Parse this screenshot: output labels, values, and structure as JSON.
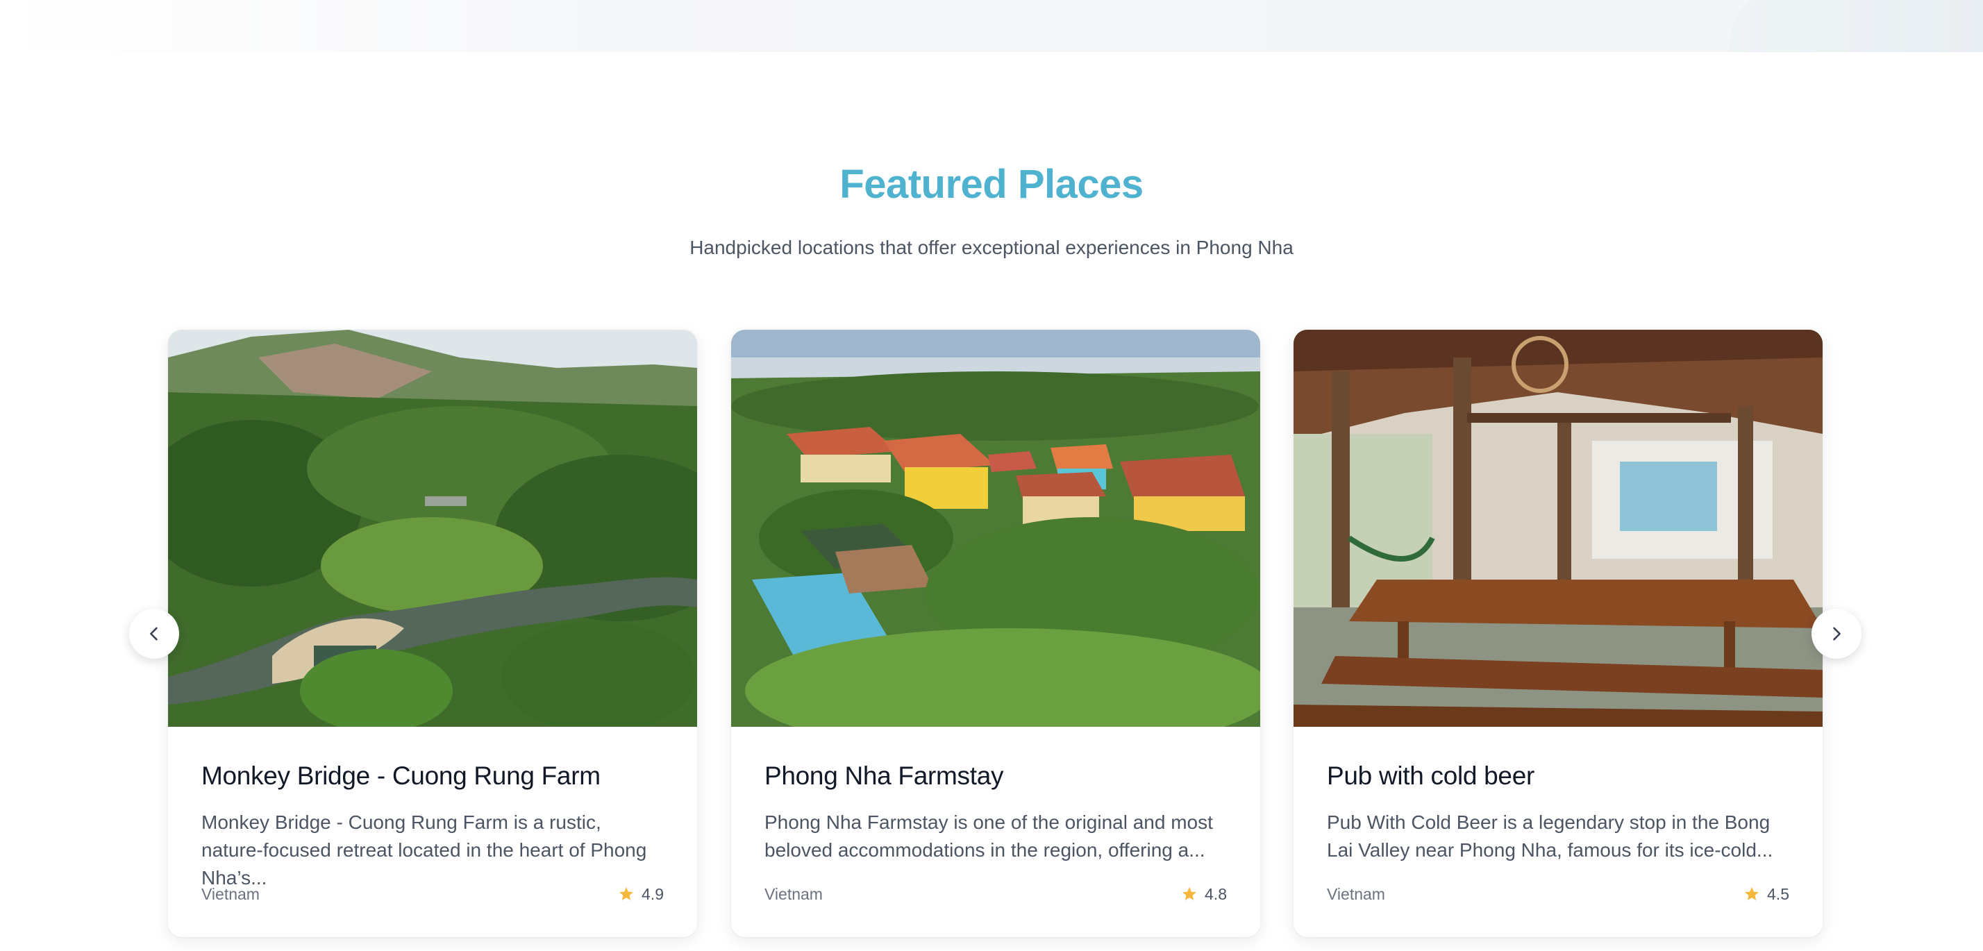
{
  "section": {
    "title": "Featured Places",
    "subtitle": "Handpicked locations that offer exceptional experiences in Phong Nha"
  },
  "carousel": {
    "prev_icon": "chevron-left-icon",
    "next_icon": "chevron-right-icon"
  },
  "cards": [
    {
      "title": "Monkey Bridge - Cuong Rung Farm",
      "description": "Monkey Bridge - Cuong Rung Farm is a rustic, nature-focused retreat located in the heart of Phong Nha’s...",
      "location": "Vietnam",
      "rating": "4.9",
      "image": "aerial view of forested river valley with farm"
    },
    {
      "title": "Phong Nha Farmstay",
      "description": "Phong Nha Farmstay is one of the original and most beloved accommodations in the region, offering a...",
      "location": "Vietnam",
      "rating": "4.8",
      "image": "aerial view of colorful farmstay buildings with pool"
    },
    {
      "title": "Pub with cold beer",
      "description": "Pub With Cold Beer is a legendary stop in the Bong Lai Valley near Phong Nha, famous for its ice-cold...",
      "location": "Vietnam",
      "rating": "4.5",
      "image": "open wooden pavilion with long tables and hammock"
    }
  ],
  "colors": {
    "accent": "#4fb3cf",
    "star": "#f5b83d"
  }
}
